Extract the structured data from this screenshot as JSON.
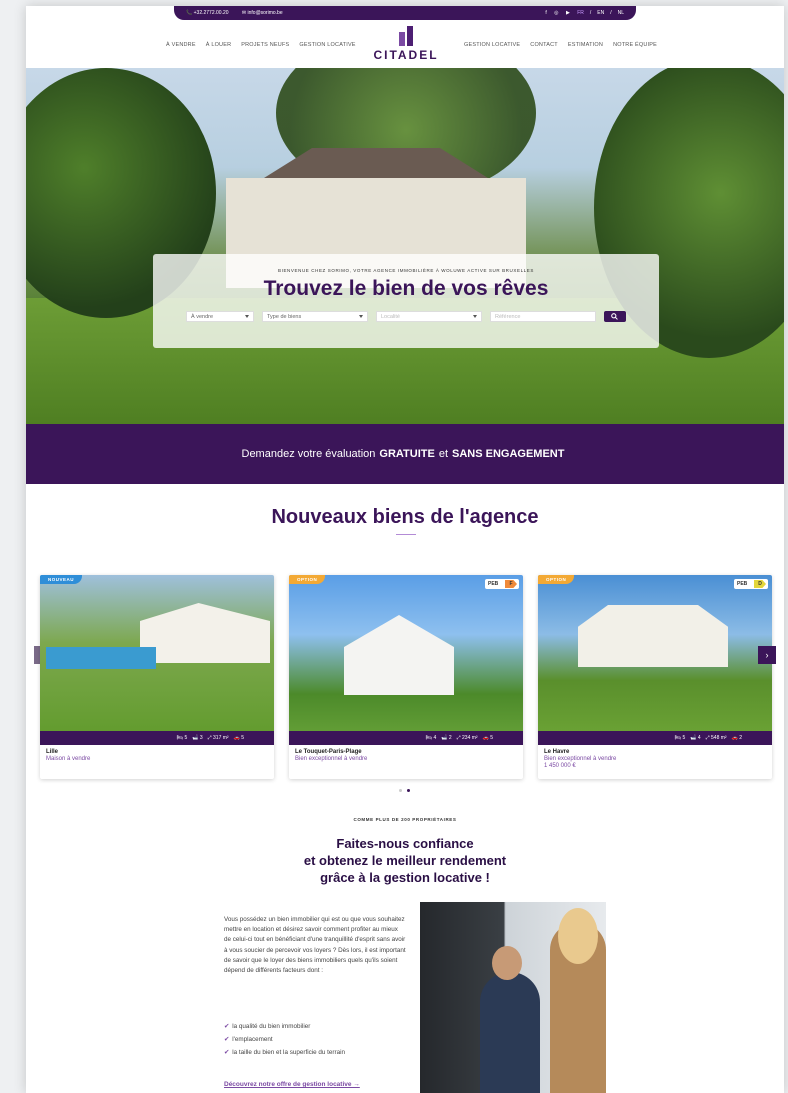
{
  "topbar": {
    "phone": "+32.2772.00.20",
    "email": "info@sorimo.be",
    "social": [
      "f",
      "◎",
      "▶"
    ],
    "langs": [
      "FR",
      "EN",
      "NL"
    ],
    "lang_sep": "/"
  },
  "nav": {
    "left": [
      "À VENDRE",
      "À LOUER",
      "PROJETS NEUFS",
      "GESTION LOCATIVE"
    ],
    "right": [
      "GESTION LOCATIVE",
      "CONTACT",
      "ESTIMATION",
      "NOTRE ÉQUIPE"
    ],
    "logo": "CITADEL"
  },
  "hero": {
    "kicker": "BIENVENUE CHEZ SORIMO, VOTRE AGENCE IMMOBILIÈRE À WOLUWE ACTIVE SUR BRUXELLES",
    "title": "Trouvez le bien de vos rêves",
    "search": {
      "mode": "À vendre",
      "type": "Type de biens",
      "locality_placeholder": "Localité",
      "reference_placeholder": "Référence"
    }
  },
  "banner": {
    "pre": "Demandez votre évaluation",
    "bold1": "GRATUITE",
    "mid": "et",
    "bold2": "SANS ENGAGEMENT"
  },
  "listings": {
    "title": "Nouveaux biens de l'agence",
    "cards": [
      {
        "badge": "NOUVEAU",
        "badge_color": "#2f8ed8",
        "peb": "",
        "beds": "5",
        "baths": "3",
        "area": "317 m²",
        "cars": "5",
        "city": "Lille",
        "type": "Maison à vendre",
        "price": ""
      },
      {
        "badge": "OPTION",
        "badge_color": "#f3a935",
        "peb": "F",
        "peb_color": "#f08a3a",
        "beds": "4",
        "baths": "2",
        "area": "234 m²",
        "cars": "5",
        "city": "Le Touquet-Paris-Plage",
        "type": "Bien exceptionnel à vendre",
        "price": ""
      },
      {
        "badge": "OPTION",
        "badge_color": "#f3a935",
        "peb": "D",
        "peb_color": "#e3d63b",
        "beds": "5",
        "baths": "4",
        "area": "548 m²",
        "cars": "2",
        "city": "Le Havre",
        "type": "Bien exceptionnel à vendre",
        "price": "1 450 000 €"
      }
    ],
    "peb_label": "PEB",
    "prev": "‹",
    "next": "›"
  },
  "trust": {
    "kicker": "COMME PLUS DE 200 PROPRIÉTAIRES",
    "title_lines": [
      "Faites-nous confiance",
      "et obtenez le meilleur rendement",
      "grâce à la gestion locative !"
    ],
    "text": "Vous possédez un bien immobilier qui est ou que vous souhaitez mettre en location et désirez savoir comment profiter au mieux de celui-ci tout en bénéficiant d'une tranquillité d'esprit sans avoir à vous soucier de percevoir vos loyers ? Dès lors, il est important de savoir que le loyer des biens immobiliers quels qu'ils soient dépend de différents facteurs dont :",
    "list": [
      "la qualité du bien immobilier",
      "l'emplacement",
      "la taille du bien et la superficie du terrain"
    ],
    "link": "Découvrez notre offre de gestion locative →"
  }
}
